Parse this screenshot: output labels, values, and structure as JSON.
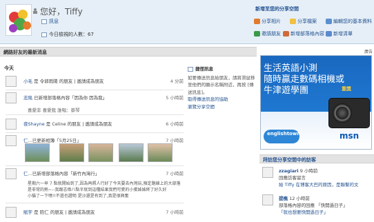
{
  "header": {
    "greeting": "您好，Tiffy",
    "messages": "訊息",
    "visits": "今日檢視的人數：67",
    "new_space_title": "新增至您的分享空間",
    "shortcuts": [
      {
        "label": "分享相片",
        "icon": "photo-icon",
        "color": "#e07b2e"
      },
      {
        "label": "分享檔案",
        "icon": "file-icon",
        "color": "#f0c040"
      },
      {
        "label": "編輯您的基本資料",
        "icon": "profile-edit-icon",
        "color": "#5b8fd0"
      },
      {
        "label": "邀請朋友",
        "icon": "invite-icon",
        "color": "#3a9a4a"
      },
      {
        "label": "新增部落格內容",
        "icon": "blog-icon",
        "color": "#d06a3a"
      },
      {
        "label": "新增清單",
        "icon": "list-icon",
        "color": "#5a8ad0"
      }
    ]
  },
  "friends_section": {
    "title": "網路好友的最新消息",
    "today": "今天",
    "feed": [
      {
        "text_pre": "小毛",
        "text_rest": "是 令郭雨陽 的朋友 | 邀請成為朋友",
        "time": "4 分前"
      },
      {
        "text_pre": "志銘",
        "text_rest": "已新增部落格內容「因為你 因為我」",
        "time": "5 小時前",
        "sub": "喜愛非 喜愛我 誰唱：蔡琴"
      },
      {
        "text_pre": "夜Shayne",
        "text_rest": "是 Celine 的朋友 | 邀請成為朋友",
        "time": "6 小時前"
      },
      {
        "text_pre": "仁",
        "text_rest": "...已更新相簿「5月25日」",
        "time": "7 小時前"
      },
      {
        "text_pre": "仁",
        "text_rest": "...已新增部落格內容「新竹內灣行」",
        "time": "7 小時前",
        "sub": "星期六一早 7 點就開始到了,因為再照人行好了今天要去內灣玩,預定路線是上的大部落。"
      },
      {
        "text_pre": "賦宇",
        "text_rest": "是 陪仁 的朋友 | 邀請成為朋友",
        "time": "7 小時前"
      }
    ],
    "long_text_1": "星期六一早 7 點就開始到了,因為再照人行好了今天要去內灣玩,預定路線上的大部落是非常的熱~--我跟志偉八點半就到這種結果我們可愛的小蛋姊姊終了好久好",
    "long_text_2": "小貓了一下嘿!!不過也證明 是沙還是有到了,真是很興奮"
  },
  "note": {
    "title": "捷徑訊息",
    "body": "如要傳送訊息給朋友，請將滑鼠移至他們的顯示名稱附近，再按 [傳送訊息]。",
    "links": [
      "取得傳送訊息的協助",
      "瀏覽分享空間"
    ]
  },
  "ad": {
    "label": "廣告",
    "line1": "生活英語小測",
    "line2": "隨時贏走數碼相機或",
    "line3": "牛津遊學團",
    "badge": "重獎",
    "brand1": "englishtown",
    "brand2": "msn"
  },
  "visitors": {
    "title": "拜訪您分享空間中的訪客",
    "items": [
      {
        "name": "zzagiari",
        "time": "9 小時前",
        "msg": "回應訪客留言",
        "detail": "給 Tiffy 在博客大巴的原因，是聯繫的文"
      },
      {
        "name": "提樵",
        "time": "12 小時前",
        "msg": "部落格內容的回應 「快開過日子」",
        "detail": "「就也想要快開過日子」"
      }
    ]
  }
}
